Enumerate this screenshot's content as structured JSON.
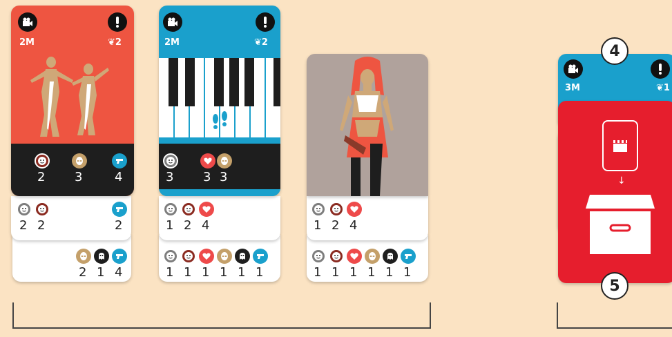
{
  "colors": {
    "background": "#fbe3c3",
    "red_card": "#ee5541",
    "blue_card": "#1aa0cc",
    "red_action": "#e61e2d",
    "dark_band": "#1e1e1e"
  },
  "card1": {
    "cost": "2M",
    "award": "2",
    "band_values": [
      "2",
      "3",
      "4"
    ],
    "strip1_values": [
      "2",
      "2",
      "2"
    ],
    "strip2_values": [
      "2",
      "1",
      "4"
    ],
    "band_icons": [
      "brown-face-icon",
      "gold-alien-icon",
      "blue-gun-icon"
    ],
    "strip1_icons": [
      "gray-face-icon",
      "brown-face-icon",
      "blue-gun-icon"
    ],
    "strip2_icons": [
      "gold-alien-icon",
      "black-ghost-icon",
      "blue-gun-icon"
    ]
  },
  "card2": {
    "cost": "2M",
    "award": "2",
    "band_values": [
      "3",
      "3",
      "3"
    ],
    "strip1_values": [
      "1",
      "2",
      "4"
    ],
    "strip2_values": [
      "1",
      "1",
      "1",
      "1",
      "1",
      "1"
    ],
    "band_icons": [
      "gray-face-icon",
      "red-heart-icon",
      "gold-alien-icon"
    ],
    "strip1_icons": [
      "gray-face-icon",
      "brown-face-icon",
      "red-heart-icon"
    ],
    "strip2_icons": [
      "gray-face-icon",
      "brown-face-icon",
      "red-heart-icon",
      "gold-alien-icon",
      "black-ghost-icon",
      "blue-gun-icon"
    ]
  },
  "card3": {
    "strip1_values": [
      "1",
      "2",
      "4"
    ],
    "strip2_values": [
      "1",
      "1",
      "1",
      "1",
      "1",
      "1"
    ],
    "strip1_icons": [
      "gray-face-icon",
      "brown-face-icon",
      "red-heart-icon"
    ],
    "strip2_icons": [
      "gray-face-icon",
      "brown-face-icon",
      "red-heart-icon",
      "gold-alien-icon",
      "black-ghost-icon",
      "blue-gun-icon"
    ]
  },
  "card4": {
    "cost": "3M",
    "award": "1",
    "badge_top": "4",
    "badge_bottom": "5"
  }
}
